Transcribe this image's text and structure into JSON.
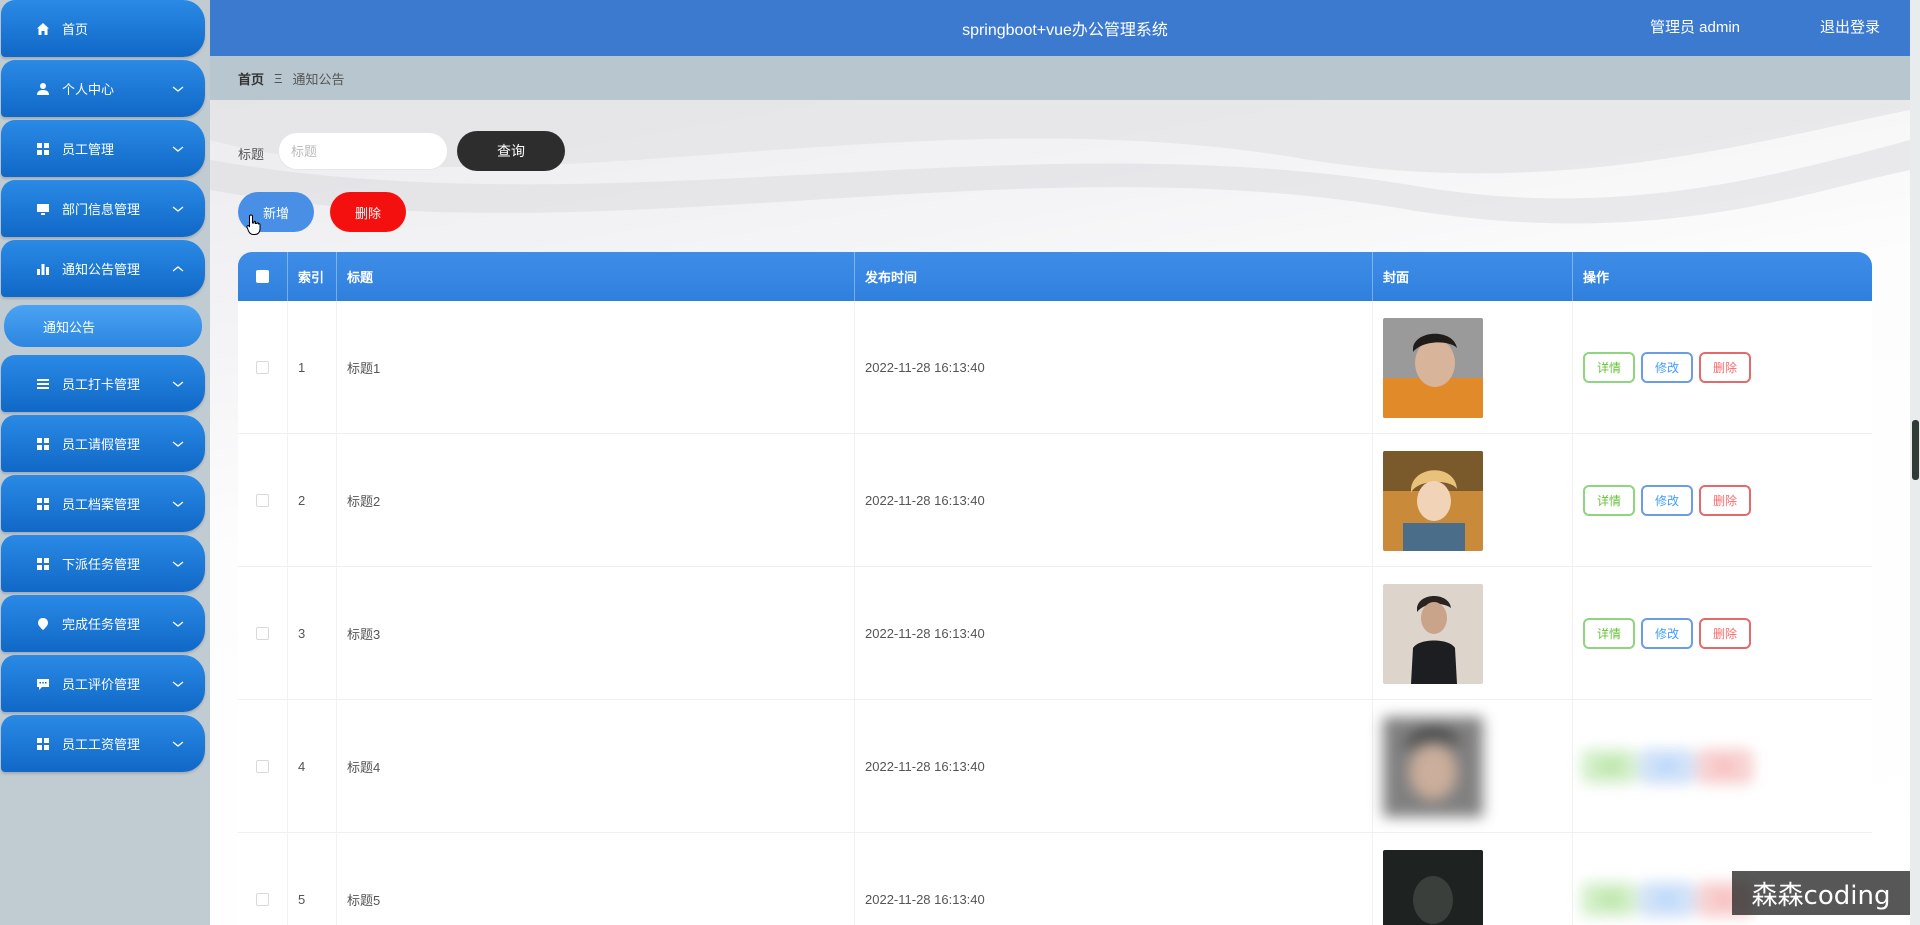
{
  "app": {
    "title": "springboot+vue办公管理系统",
    "user": "管理员 admin",
    "logout": "退出登录"
  },
  "sidebar": {
    "items": [
      {
        "label": "首页",
        "icon": "home-icon"
      },
      {
        "label": "个人中心",
        "icon": "user-icon"
      },
      {
        "label": "员工管理",
        "icon": "grid-icon"
      },
      {
        "label": "部门信息管理",
        "icon": "monitor-icon"
      },
      {
        "label": "通知公告管理",
        "icon": "bar-chart-icon",
        "expanded": true
      },
      {
        "label": "员工打卡管理",
        "icon": "list-icon"
      },
      {
        "label": "员工请假管理",
        "icon": "grid-icon"
      },
      {
        "label": "员工档案管理",
        "icon": "grid-icon"
      },
      {
        "label": "下派任务管理",
        "icon": "grid-icon"
      },
      {
        "label": "完成任务管理",
        "icon": "location-icon"
      },
      {
        "label": "员工评价管理",
        "icon": "chat-icon"
      },
      {
        "label": "员工工资管理",
        "icon": "grid-icon"
      }
    ],
    "active_sub": "通知公告"
  },
  "breadcrumb": {
    "home": "首页",
    "separator": "Ξ",
    "current": "通知公告"
  },
  "search": {
    "label": "标题",
    "placeholder": "标题",
    "query": "查询"
  },
  "actions": {
    "add": "新增",
    "delete": "删除"
  },
  "table": {
    "headers": {
      "index": "索引",
      "title": "标题",
      "time": "发布时间",
      "cover": "封面",
      "ops": "操作"
    },
    "rows": [
      {
        "index": "1",
        "title": "标题1",
        "time": "2022-11-28 16:13:40"
      },
      {
        "index": "2",
        "title": "标题2",
        "time": "2022-11-28 16:13:40"
      },
      {
        "index": "3",
        "title": "标题3",
        "time": "2022-11-28 16:13:40"
      },
      {
        "index": "4",
        "title": "标题4",
        "time": "2022-11-28 16:13:40"
      },
      {
        "index": "5",
        "title": "标题5",
        "time": "2022-11-28 16:13:40"
      }
    ],
    "ops": {
      "detail": "详情",
      "edit": "修改",
      "delete": "删除"
    }
  },
  "watermark": "森森coding",
  "colors": {
    "header": "#3c7ad0",
    "menu": "#1168c6",
    "delete": "#f51010",
    "query": "#2d2d2d"
  }
}
